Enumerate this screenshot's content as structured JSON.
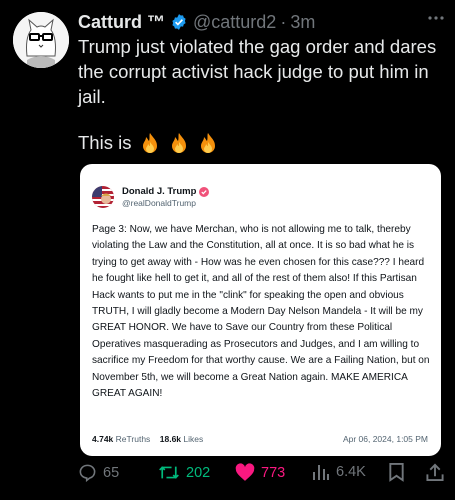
{
  "author": {
    "name": "Catturd ™",
    "handle": "@catturd2",
    "separator": "·",
    "time": "3m"
  },
  "tweet": {
    "text": "Trump just violated the gag order and dares the corrupt activist hack judge to put him in jail.",
    "this_is": "This is"
  },
  "quoted_post": {
    "name": "Donald J. Trump",
    "handle": "@realDonaldTrump",
    "body": "Page 3: Now, we have Merchan, who is not allowing me to talk, thereby violating the Law and the Constitution, all at once. It is so bad what he is trying to get away with - How was he even chosen for this case??? I heard he fought like hell to get it, and all of the rest of them also! If this Partisan Hack wants to put me in the \"clink\" for speaking the open and obvious TRUTH, I will gladly become a Modern Day Nelson Mandela - It will be my GREAT HONOR. We have to Save our Country from these Political Operatives masquerading as Prosecutors and Judges, and I am willing to sacrifice my Freedom for that worthy cause. We are a Failing Nation, but on November 5th, we will become a Great Nation again. MAKE AMERICA GREAT AGAIN!",
    "retruths_count": "4.74k",
    "retruths_label": "ReTruths",
    "likes_count": "18.6k",
    "likes_label": "Likes",
    "date": "Apr 06, 2024, 1:05 PM"
  },
  "actions": {
    "replies": "65",
    "reposts": "202",
    "likes": "773",
    "views": "6.4K"
  },
  "colors": {
    "background": "#000000",
    "verified": "#1d9bf0",
    "repost": "#00ba7c",
    "like": "#f91880",
    "muted": "#71767b"
  }
}
